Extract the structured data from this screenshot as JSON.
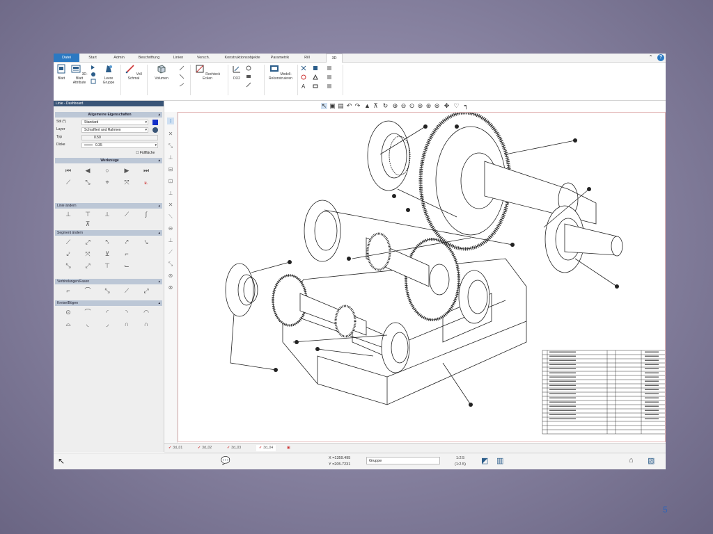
{
  "ribbon_tabs": [
    "Datei",
    "Start",
    "Admin",
    "Beschriftung",
    "Linien",
    "Versch.",
    "Konstruktionsobjekte",
    "Parametrik",
    "Rill",
    "3D"
  ],
  "ribbon_buttons": {
    "blatt": "Blatt",
    "blatt_attribute": "3D-Blatt Attribute",
    "leere_gruppe": "Leere Gruppe",
    "voll_schmal": "Voll Schmal",
    "volumen": "Volumen",
    "rechteck_ecken": "Rechteck Ecken",
    "dx2": "DX2",
    "modell_rekonstruieren": "Modell-Rekonstruieren"
  },
  "panel": {
    "title": "Linie - Dashboard",
    "sec_props": "Allgemeine Eigenschaften",
    "fields": [
      {
        "label": "Stil (*)",
        "value": "Standard"
      },
      {
        "label": "Layer",
        "value": "Schraffiert und Rahmen"
      },
      {
        "label": "Typ",
        "value": "0.50"
      },
      {
        "label": "Dicke",
        "value": "0.35"
      }
    ],
    "fill_label": "Füllfläche",
    "sec_tools": "Werkzeuge",
    "sec_line": "Linie ändern",
    "sec_segment": "Segment ändern",
    "sec_connect": "Verbindungen/Fasen",
    "sec_arc": "Kreise/Bögen"
  },
  "sheet_tabs": [
    "3d_01",
    "3d_02",
    "3d_03",
    "3d_04"
  ],
  "status": {
    "coord_x": "X =1359.495",
    "coord_y": "Y =205.7231",
    "group_value": "Gruppe",
    "scale_top": "1:2.5",
    "scale_bottom": "(1:2.5)"
  },
  "slide_number": "5",
  "colors": {
    "accent": "#2b79c2",
    "panel_header": "#3a5577",
    "section": "#bcc7d6"
  }
}
